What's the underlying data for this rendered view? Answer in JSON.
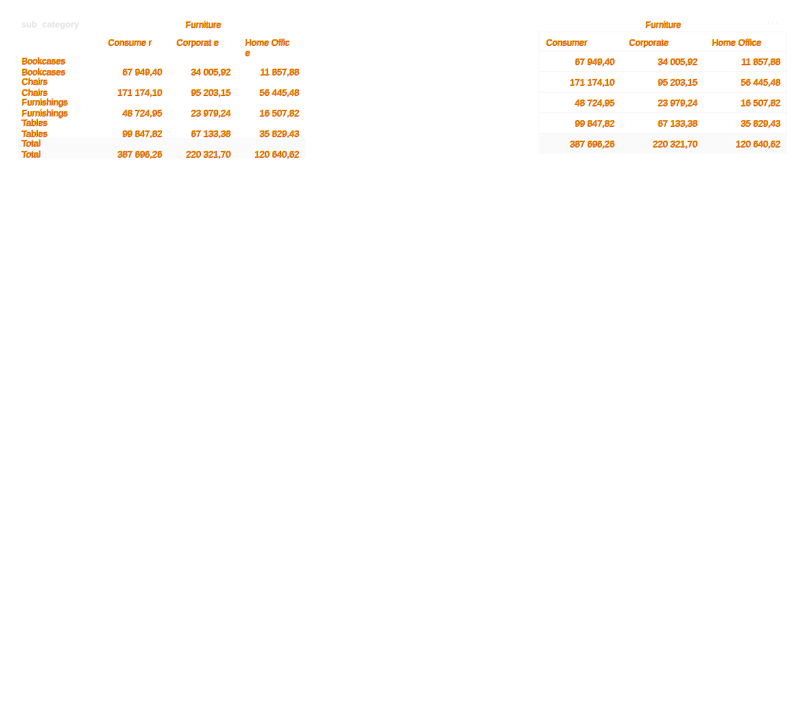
{
  "left_table": {
    "row_header_key": "sub_category",
    "group_header": "Furniture",
    "columns": [
      "Consume r",
      "Corporat e",
      "Home Office"
    ],
    "rows": [
      {
        "label": "Bookcases",
        "values": [
          "67 949,40",
          "34 005,92",
          "11 857,88"
        ]
      },
      {
        "label": "Chairs",
        "values": [
          "171 174,10",
          "95 203,15",
          "56 445,48"
        ]
      },
      {
        "label": "Furnishings",
        "values": [
          "48 724,95",
          "23 979,24",
          "16 507,82"
        ]
      },
      {
        "label": "Tables",
        "values": [
          "99 847,82",
          "67 133,38",
          "35 829,43"
        ]
      }
    ],
    "total": {
      "label": "Total",
      "values": [
        "387 696,26",
        "220 321,70",
        "120 640,62"
      ]
    }
  },
  "right_table": {
    "group_header": "Furniture",
    "more_menu": "···",
    "columns": [
      "Consumer",
      "Corporate",
      "Home Office"
    ],
    "rows": [
      {
        "values": [
          "67 949,40",
          "34 005,92",
          "11 857,88"
        ]
      },
      {
        "values": [
          "171 174,10",
          "95 203,15",
          "56 445,48"
        ]
      },
      {
        "values": [
          "48 724,95",
          "23 979,24",
          "16 507,82"
        ]
      },
      {
        "values": [
          "99 847,82",
          "67 133,38",
          "35 829,43"
        ]
      }
    ],
    "total": {
      "values": [
        "387 696,26",
        "220 321,70",
        "120 640,62"
      ]
    }
  },
  "colors": {
    "text_fill": "#f2c200",
    "text_outline": "#d01a00",
    "faint": "#e2e2e2"
  }
}
